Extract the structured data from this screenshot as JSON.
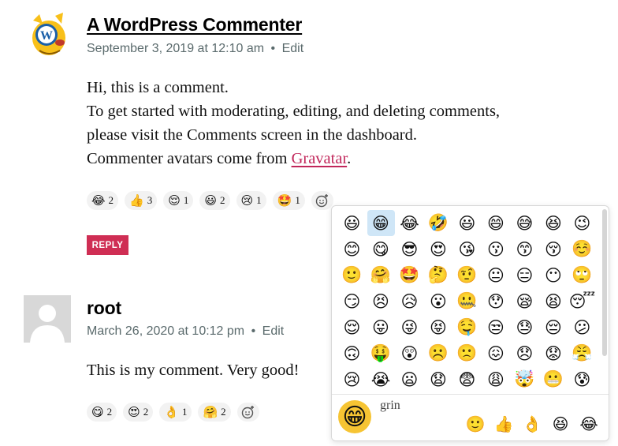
{
  "comment1": {
    "author": "A WordPress Commenter",
    "date": "September 3, 2019 at 12:10 am",
    "separator": "•",
    "edit_label": "Edit",
    "paragraphs": [
      "Hi, this is a comment.",
      "To get started with moderating, editing, and deleting comments,",
      "please visit the Comments screen in the dashboard."
    ],
    "avatar_line_prefix": "Commenter avatars come from ",
    "avatar_link": "Gravatar",
    "avatar_line_suffix": ".",
    "reactions": [
      {
        "emoji": "😂",
        "count": "2"
      },
      {
        "emoji": "👍",
        "count": "3"
      },
      {
        "emoji": "😌",
        "count": "1"
      },
      {
        "emoji": "😃",
        "count": "2"
      },
      {
        "emoji": "😢",
        "count": "1"
      },
      {
        "emoji": "🤩",
        "count": "1"
      }
    ],
    "reply_label": "REPLY"
  },
  "comment2": {
    "author": "root",
    "date": "March 26, 2020 at 10:12 pm",
    "separator": "•",
    "edit_label": "Edit",
    "text": "This is my comment. Very good!",
    "reactions": [
      {
        "emoji": "😋",
        "count": "2"
      },
      {
        "emoji": "😍",
        "count": "2"
      },
      {
        "emoji": "👌",
        "count": "1"
      },
      {
        "emoji": "🤗",
        "count": "2"
      }
    ]
  },
  "picker": {
    "emojis": [
      "😃",
      "😁",
      "😂",
      "🤣",
      "😃",
      "😄",
      "😅",
      "😆",
      "😉",
      "😊",
      "😋",
      "😎",
      "😍",
      "😘",
      "😗",
      "😙",
      "😚",
      "☺️",
      "🙂",
      "🤗",
      "🤩",
      "🤔",
      "🤨",
      "😐",
      "😑",
      "😶",
      "🙄",
      "😏",
      "😣",
      "😥",
      "😮",
      "🤐",
      "😯",
      "😪",
      "😫",
      "😴",
      "😌",
      "😛",
      "😜",
      "😝",
      "🤤",
      "😒",
      "😓",
      "😔",
      "😕",
      "🙃",
      "🤑",
      "😲",
      "☹️",
      "🙁",
      "😖",
      "😞",
      "😟",
      "😤",
      "😢",
      "😭",
      "😦",
      "😧",
      "😨",
      "😩",
      "🤯",
      "😬",
      "😰"
    ],
    "selected_index": 1,
    "preview_emoji": "😁",
    "preview_name": "grin",
    "recent": [
      "🙂",
      "👍",
      "👌",
      "😆",
      "😂"
    ]
  },
  "icons": {
    "add_reaction": "add-reaction-icon"
  }
}
